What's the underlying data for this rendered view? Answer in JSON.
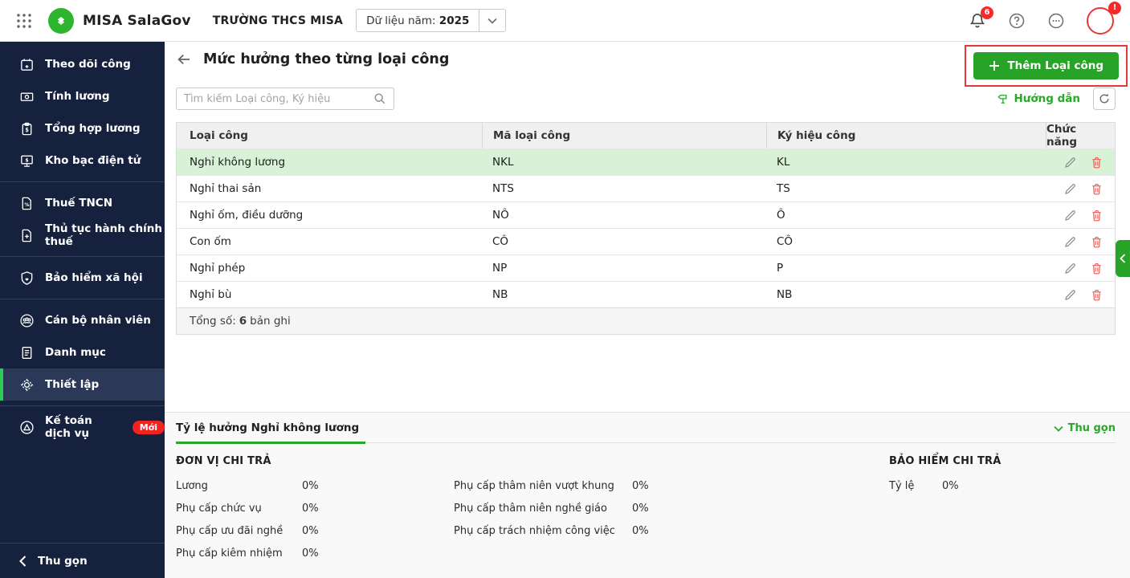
{
  "topbar": {
    "app_name": "MISA SalaGov",
    "org_name": "TRƯỜNG THCS MISA",
    "year_label": "Dữ liệu năm:",
    "year_value": "2025",
    "notification_count": "6",
    "avatar_badge": "!"
  },
  "sidebar": {
    "items": [
      {
        "label": "Theo dõi công"
      },
      {
        "label": "Tính lương"
      },
      {
        "label": "Tổng hợp lương"
      },
      {
        "label": "Kho bạc điện tử"
      },
      {
        "label": "Thuế TNCN"
      },
      {
        "label": "Thủ tục hành chính thuế"
      },
      {
        "label": "Bảo hiểm xã hội"
      },
      {
        "label": "Cán bộ nhân viên"
      },
      {
        "label": "Danh mục"
      },
      {
        "label": "Thiết lập"
      },
      {
        "label": "Kế toán dịch vụ",
        "badge": "Mới"
      }
    ],
    "collapse_label": "Thu gọn"
  },
  "page": {
    "title": "Mức hưởng theo từng loại công",
    "add_button_label": "Thêm Loại công",
    "search_placeholder": "Tìm kiếm Loại công, Ký hiệu",
    "guide_label": "Hướng dẫn"
  },
  "table": {
    "columns": [
      "Loại công",
      "Mã loại công",
      "Ký hiệu công",
      "Chức năng"
    ],
    "rows": [
      {
        "name": "Nghỉ không lương",
        "code": "NKL",
        "symbol": "KL"
      },
      {
        "name": "Nghỉ thai sản",
        "code": "NTS",
        "symbol": "TS"
      },
      {
        "name": "Nghỉ ốm, điều dưỡng",
        "code": "NÔ",
        "symbol": "Ô"
      },
      {
        "name": "Con ốm",
        "code": "CÔ",
        "symbol": "CÔ"
      },
      {
        "name": "Nghỉ phép",
        "code": "NP",
        "symbol": "P"
      },
      {
        "name": "Nghỉ bù",
        "code": "NB",
        "symbol": "NB"
      }
    ],
    "footer": {
      "label": "Tổng số:",
      "count": "6",
      "unit": "bản ghi"
    }
  },
  "panel": {
    "tab_label": "Tỷ lệ hưởng Nghỉ không lương",
    "collapse_label": "Thu gọn",
    "unit_section_title": "ĐƠN VỊ CHI TRẢ",
    "insurance_section_title": "BẢO HIỂM CHI TRẢ",
    "unit_items_left": [
      {
        "label": "Lương",
        "value": "0%"
      },
      {
        "label": "Phụ cấp chức vụ",
        "value": "0%"
      },
      {
        "label": "Phụ cấp ưu đãi nghề",
        "value": "0%"
      },
      {
        "label": "Phụ cấp kiêm nhiệm",
        "value": "0%"
      }
    ],
    "unit_items_right": [
      {
        "label": "Phụ cấp thâm niên vượt khung",
        "value": "0%"
      },
      {
        "label": "Phụ cấp thâm niên nghề giáo",
        "value": "0%"
      },
      {
        "label": "Phụ cấp trách nhiệm công việc",
        "value": "0%"
      }
    ],
    "insurance_items": [
      {
        "label": "Tỷ lệ",
        "value": "0%"
      }
    ]
  },
  "colors": {
    "brand_green": "#2aa62a",
    "sidebar_bg": "#16213e",
    "selected_row_green": "#d7f2d7",
    "annotation_red": "#e53935",
    "badge_red": "#f42a2a"
  }
}
